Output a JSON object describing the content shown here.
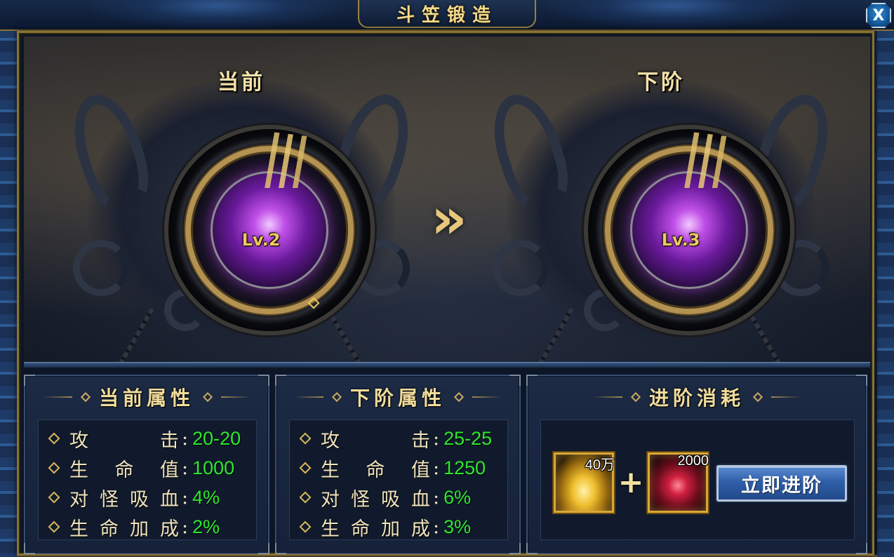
{
  "window": {
    "title": "斗笠锻造",
    "close_label": "X"
  },
  "current": {
    "label": "当前",
    "level": "Lv.2"
  },
  "next": {
    "label": "下阶",
    "level": "Lv.3"
  },
  "arrow": "»",
  "current_stats": {
    "title": "当前属性",
    "rows": [
      {
        "label": "攻击",
        "value": "20-20"
      },
      {
        "label": "生命值",
        "value": "1000"
      },
      {
        "label": "对怪吸血",
        "value": "4%"
      },
      {
        "label": "生命加成",
        "value": "2%"
      }
    ]
  },
  "next_stats": {
    "title": "下阶属性",
    "rows": [
      {
        "label": "攻击",
        "value": "25-25"
      },
      {
        "label": "生命值",
        "value": "1250"
      },
      {
        "label": "对怪吸血",
        "value": "6%"
      },
      {
        "label": "生命加成",
        "value": "3%"
      }
    ]
  },
  "cost": {
    "title": "进阶消耗",
    "items": [
      {
        "icon": "gold-ingot-icon",
        "count": "40万"
      },
      {
        "icon": "red-gem-icon",
        "count": "2000"
      }
    ],
    "plus": "+",
    "button_label": "立即进阶"
  },
  "colors": {
    "title_gold": "#f2d98a",
    "stat_value_green": "#2ee82e",
    "button_blue": "#2f5ea8"
  }
}
